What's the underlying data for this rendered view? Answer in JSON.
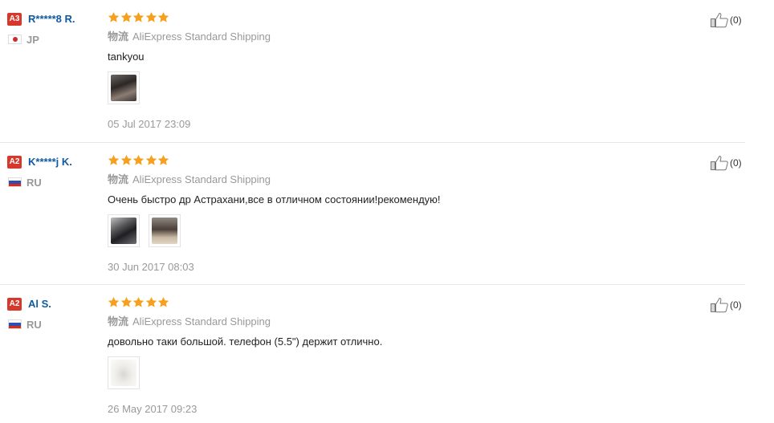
{
  "colors": {
    "badge": "#d7382c",
    "user_name": "#0f5aa0",
    "star": "#f7a01d",
    "muted": "#999999"
  },
  "reviews": [
    {
      "level": "A3",
      "user": "R*****8 R.",
      "country_code": "JP",
      "flag": "japan-flag",
      "rating": 5,
      "shipping_label": "物流",
      "shipping_value": "AliExpress Standard Shipping",
      "text": "tankyou",
      "photos": 1,
      "date": "05 Jul 2017 23:09",
      "likes": "(0)"
    },
    {
      "level": "A2",
      "user": "K*****j K.",
      "country_code": "RU",
      "flag": "russia-flag",
      "rating": 5,
      "shipping_label": "物流",
      "shipping_value": "AliExpress Standard Shipping",
      "text": "Очень быстро др Астрахани,все в отличном состоянии!рекомендую!",
      "photos": 2,
      "date": "30 Jun 2017 08:03",
      "likes": "(0)"
    },
    {
      "level": "A2",
      "user": "Al S.",
      "country_code": "RU",
      "flag": "russia-flag",
      "rating": 5,
      "shipping_label": "物流",
      "shipping_value": "AliExpress Standard Shipping",
      "text": "довольно таки большой. телефон (5.5\") держит отлично.",
      "photos": 1,
      "date": "26 May 2017 09:23",
      "likes": "(0)"
    }
  ]
}
